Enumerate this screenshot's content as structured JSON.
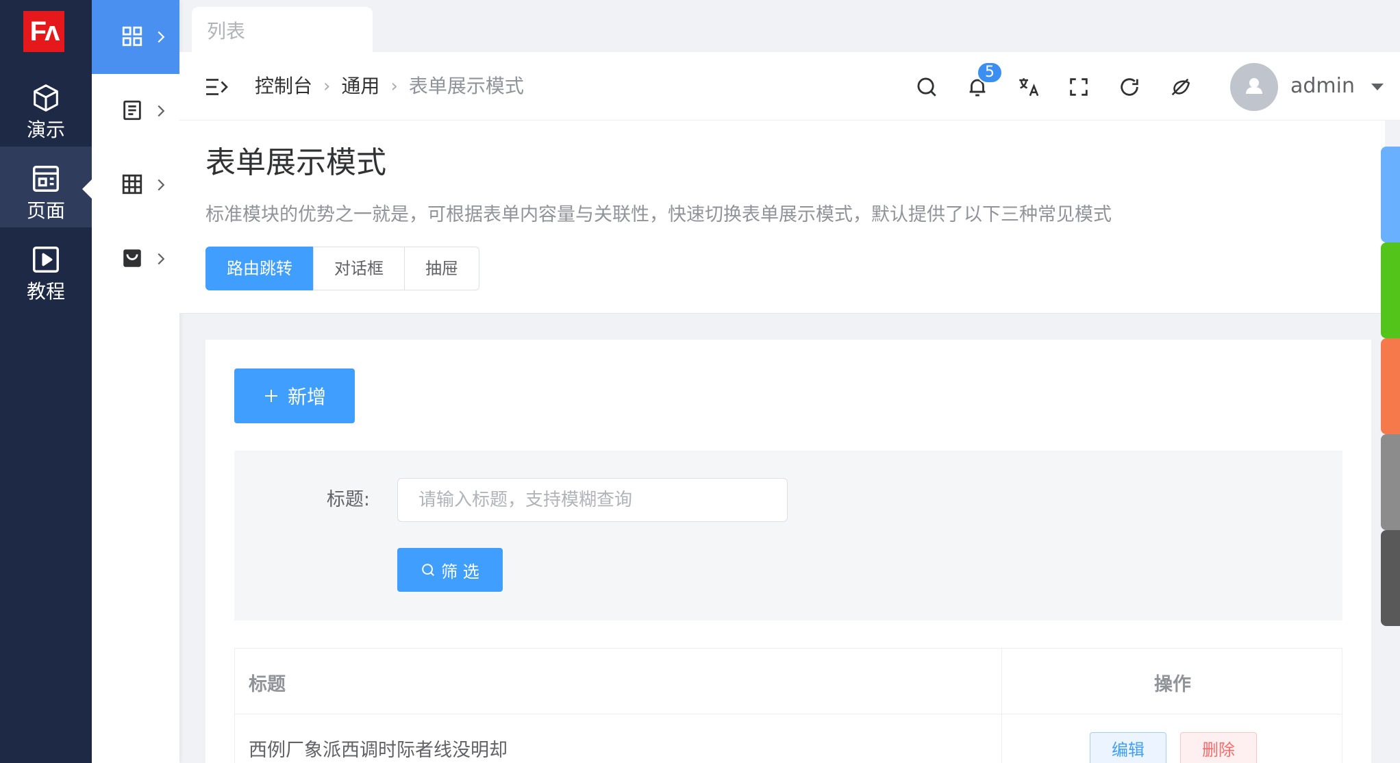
{
  "logo": {
    "text": "Fʌ"
  },
  "primary_nav": [
    {
      "label": "演示",
      "icon": "cube-icon"
    },
    {
      "label": "页面",
      "icon": "page-icon",
      "active": true
    },
    {
      "label": "教程",
      "icon": "play-icon"
    }
  ],
  "secondary_nav": [
    {
      "icon": "grid-icon",
      "active": true
    },
    {
      "icon": "document-icon"
    },
    {
      "icon": "table-icon"
    },
    {
      "icon": "bag-icon"
    }
  ],
  "tabs": [
    {
      "label": "列表"
    }
  ],
  "breadcrumb": {
    "items": [
      "控制台",
      "通用",
      "表单展示模式"
    ]
  },
  "header": {
    "notification_count": "5",
    "user": {
      "name": "admin"
    },
    "icons": [
      "menu-fold-icon",
      "search-icon",
      "bell-icon",
      "translate-icon",
      "fullscreen-icon",
      "refresh-icon",
      "theme-icon"
    ]
  },
  "page": {
    "title": "表单展示模式",
    "description": "标准模块的优势之一就是，可根据表单内容量与关联性，快速切换表单展示模式，默认提供了以下三种常见模式",
    "modes": [
      {
        "label": "路由跳转",
        "active": true
      },
      {
        "label": "对话框"
      },
      {
        "label": "抽屉"
      }
    ]
  },
  "toolbar": {
    "add_label": "新增"
  },
  "filter": {
    "title_label": "标题:",
    "title_placeholder": "请输入标题，支持模糊查询",
    "search_label": "筛 选"
  },
  "table": {
    "columns": [
      "标题",
      "操作"
    ],
    "rows": [
      {
        "title": "西例厂象派西调时际者线没明却",
        "actions": [
          "编辑",
          "删除"
        ]
      }
    ]
  },
  "theme_colors": [
    "#69b1ff",
    "#52c41a",
    "#f5794a",
    "#8c8c8c",
    "#595959"
  ]
}
